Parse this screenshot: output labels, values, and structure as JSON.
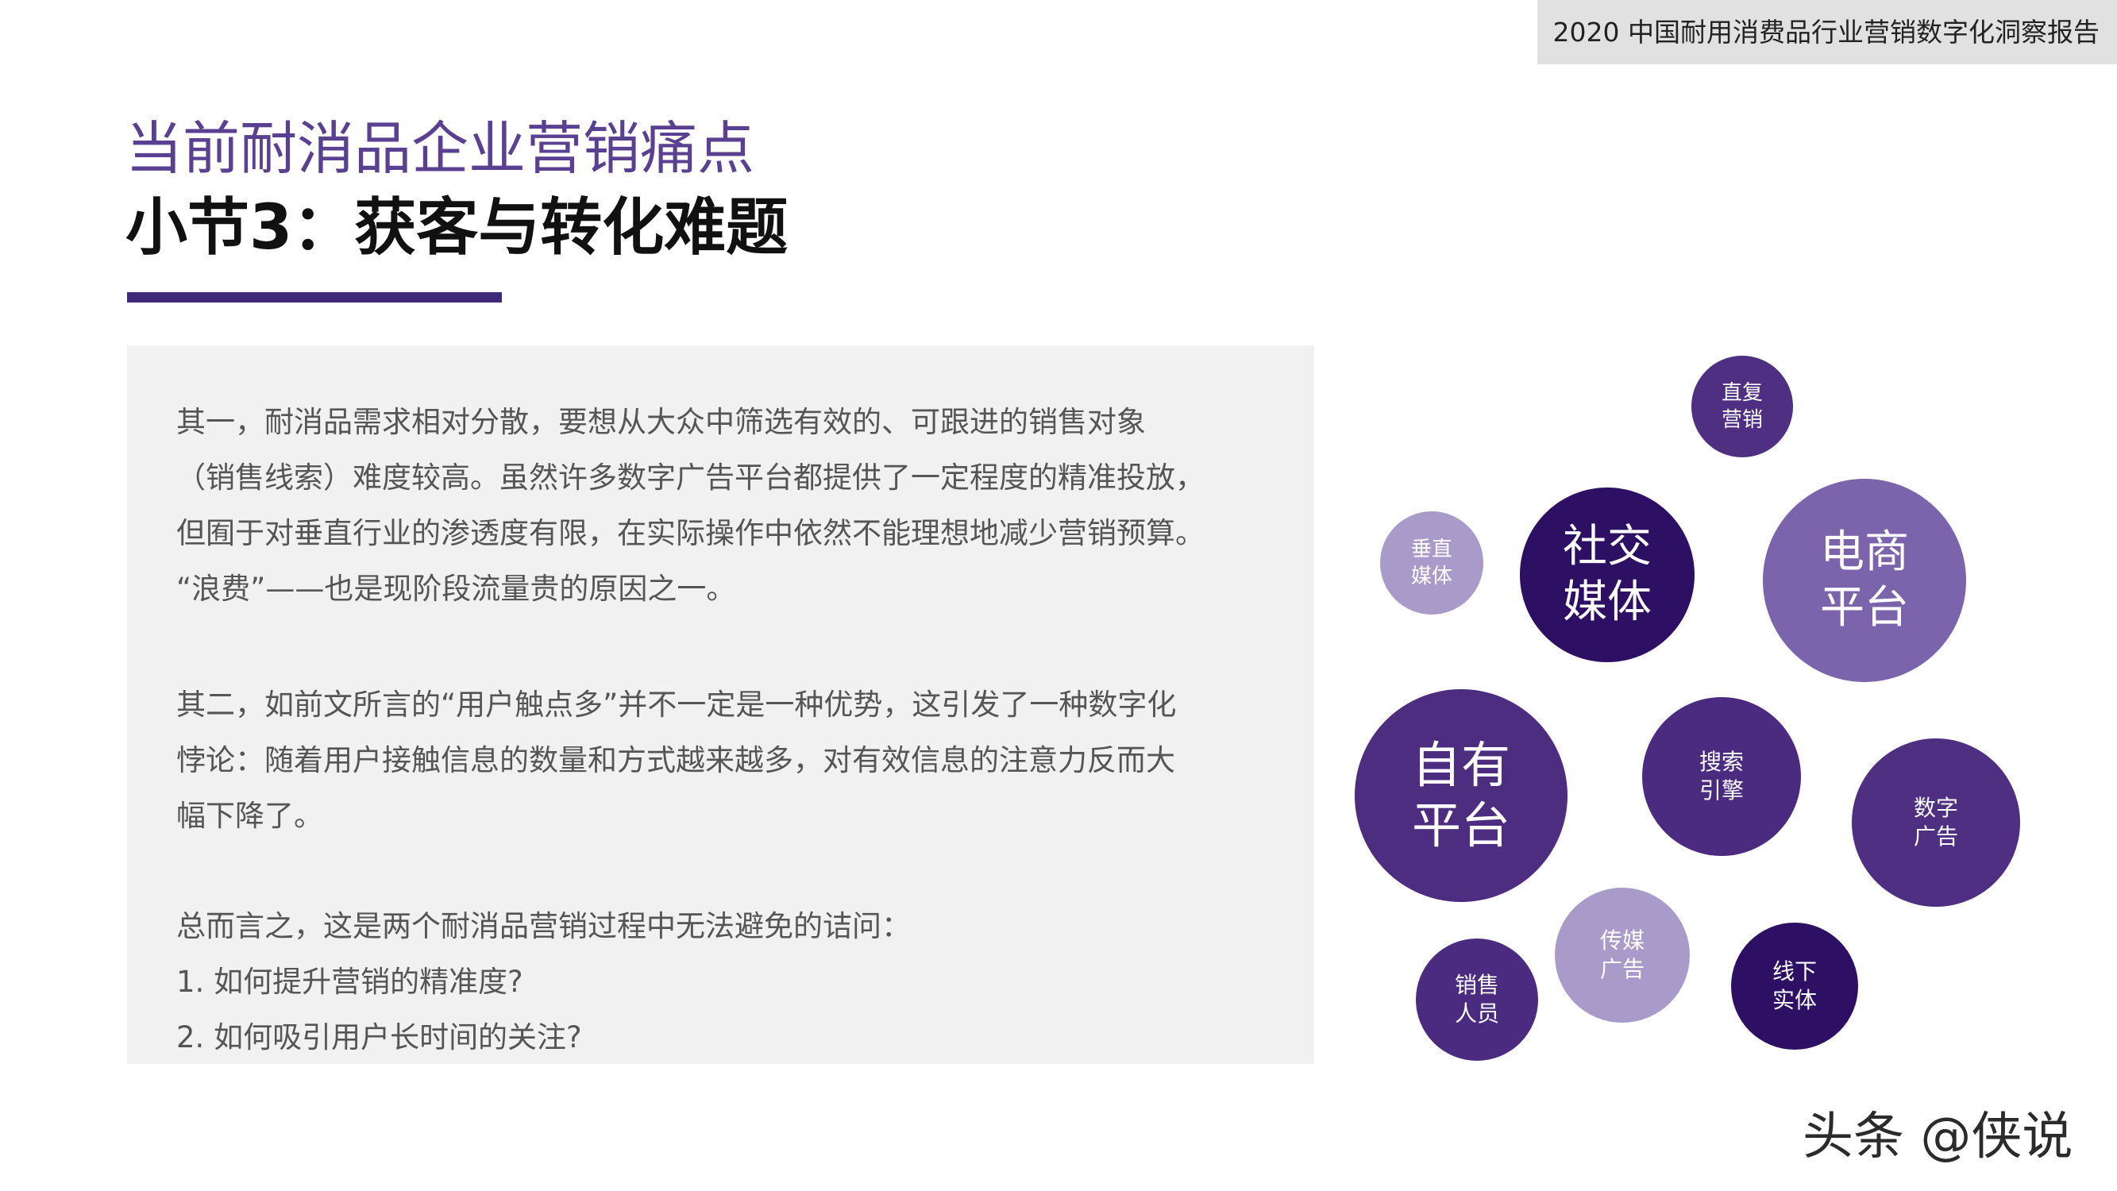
{
  "header": {
    "report_title": "2020 中国耐用消费品行业营销数字化洞察报告"
  },
  "title": {
    "main": "当前耐消品企业营销痛点",
    "sub": "小节3：获客与转化难题"
  },
  "content": {
    "paragraph1": [
      "其一，耐消品需求相对分散，要想从大众中筛选有效的、可跟进的销售对象",
      "（销售线索）难度较高。虽然许多数字广告平台都提供了一定程度的精准投放，",
      "但囿于对垂直行业的渗透度有限，在实际操作中依然不能理想地减少营销预算。",
      "“浪费”——也是现阶段流量贵的原因之一。"
    ],
    "paragraph2": [
      "其二，如前文所言的“用户触点多”并不一定是一种优势，这引发了一种数字化",
      "悖论：随着用户接触信息的数量和方式越来越多，对有效信息的注意力反而大",
      "幅下降了。"
    ],
    "paragraph3": [
      "总而言之，这是两个耐消品营销过程中无法避免的诘问：",
      "1. 如何提升营销的精准度?",
      "2. 如何吸引用户长时间的关注?"
    ]
  },
  "bubbles": [
    {
      "lines": [
        "直复",
        "营销"
      ],
      "color": "#4e2f82"
    },
    {
      "lines": [
        "垂直",
        "媒体"
      ],
      "color": "#a99bc9"
    },
    {
      "lines": [
        "社交",
        "媒体"
      ],
      "color": "#2d0f63"
    },
    {
      "lines": [
        "电商",
        "平台"
      ],
      "color": "#7b64ab"
    },
    {
      "lines": [
        "自有",
        "平台"
      ],
      "color": "#4c2d80"
    },
    {
      "lines": [
        "搜索",
        "引擎"
      ],
      "color": "#4a2b7f"
    },
    {
      "lines": [
        "数字",
        "广告"
      ],
      "color": "#4e2f82"
    },
    {
      "lines": [
        "传媒",
        "广告"
      ],
      "color": "#a99bc9"
    },
    {
      "lines": [
        "销售",
        "人员"
      ],
      "color": "#4a2b7f"
    },
    {
      "lines": [
        "线下",
        "实体"
      ],
      "color": "#2d0f63"
    }
  ],
  "watermark": "头条 @侠说",
  "colors": {
    "accent": "#3e2a78",
    "panel": "#f1f1f1",
    "header_bar": "#e1e1e1"
  }
}
